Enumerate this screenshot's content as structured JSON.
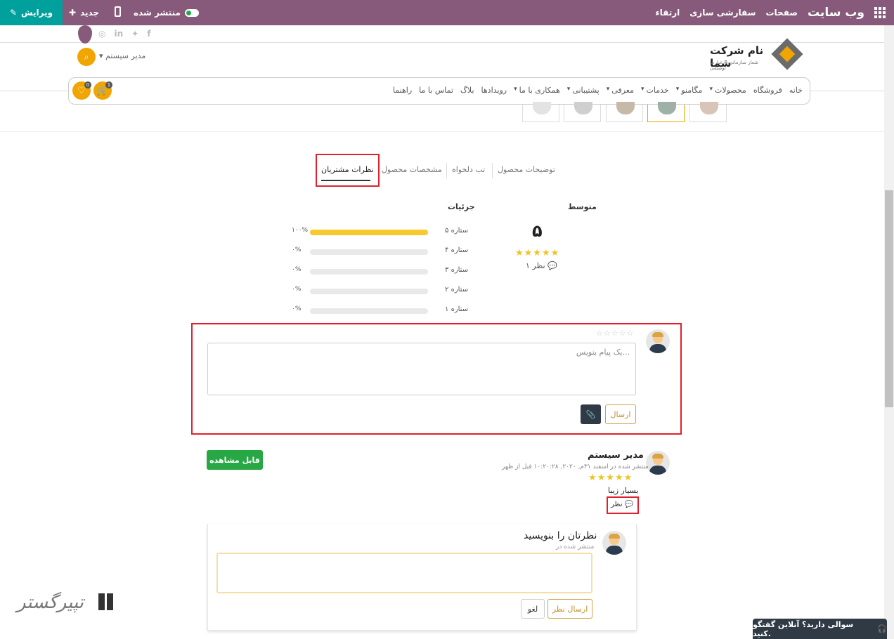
{
  "topbar": {
    "edit_label": "ویرایش",
    "new_label": "جدید",
    "published_label": "منتشر شده",
    "upgrade_label": "ارتقاء",
    "customize_label": "سفارشی سازی",
    "pages_label": "صفحات",
    "site_title": "وب سایت"
  },
  "header": {
    "admin_label": "مدیر سیستم",
    "company_name": "نام شرکت شما",
    "company_slogan": "شعار سازمانی یا عبارت توصیفی",
    "cart_count": "1",
    "wishlist_count": "0",
    "social_icons": [
      "instagram-icon",
      "linkedin-icon",
      "twitter-icon",
      "facebook-icon"
    ]
  },
  "nav": {
    "items": [
      "خانه",
      "فروشگاه",
      "محصولات",
      "مگامنو",
      "خدمات",
      "معرفی",
      "پشتیبانی",
      "همکاری با ما",
      "رویدادها",
      "بلاگ",
      "تماس با ما",
      "راهنما"
    ]
  },
  "tabs": {
    "items": [
      "توضیحات محصول",
      "تب دلخواه",
      "مشخصات محصول",
      "نظرات مشتریان"
    ],
    "active": "نظرات مشتریان"
  },
  "ratings": {
    "average_title": "متوسط",
    "details_title": "جزئیات",
    "average_value": "۵",
    "review_count": "۱ نظر",
    "rows": [
      {
        "label": "۵ ستاره",
        "percent_text": "۱۰۰%",
        "fraction": 1.0
      },
      {
        "label": "۴ ستاره",
        "percent_text": "۰%",
        "fraction": 0
      },
      {
        "label": "۳ ستاره",
        "percent_text": "۰%",
        "fraction": 0
      },
      {
        "label": "۲ ستاره",
        "percent_text": "۰%",
        "fraction": 0
      },
      {
        "label": "۱ ستاره",
        "percent_text": "۰%",
        "fraction": 0
      }
    ]
  },
  "comment_form": {
    "placeholder": "یک پیام بنویس...",
    "send_label": "ارسال"
  },
  "review": {
    "author": "مدیر سیستم",
    "meta": "منتشر شده در اسفند ۳۱م, ۲۰۲۰, ۱۰:۲۰:۲۸ قبل از ظهر",
    "text": "بسیار زیبا",
    "comment_link": "نظر",
    "visible_label": "قابل مشاهده",
    "stars": 5
  },
  "reply": {
    "title": "نظرتان را بنویسید",
    "meta": "منتشر شده در",
    "submit_label": "ارسال نظر",
    "cancel_label": "لغو"
  },
  "chat": {
    "label": "سوالی دارید؟ آنلاین گفتگو کنید."
  },
  "watermark": "تپیرگستر",
  "colors": {
    "topbar": "#875a7b",
    "edit_button": "#00a09d",
    "accent": "#f0a500",
    "highlight_box": "#e0202c",
    "rating_fill": "#f8c92c"
  }
}
